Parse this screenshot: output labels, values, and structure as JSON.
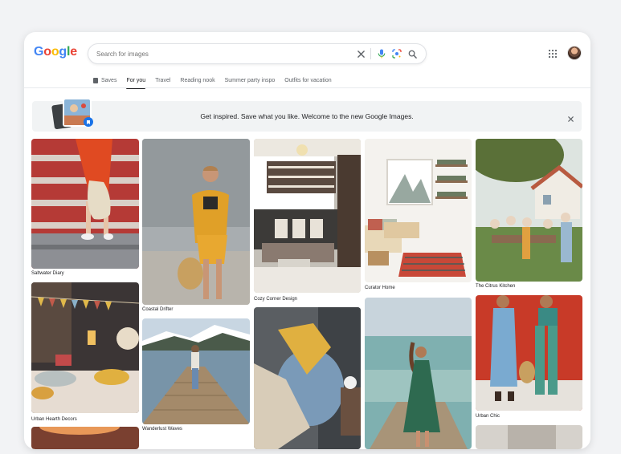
{
  "logo": {
    "letters": [
      "G",
      "o",
      "o",
      "g",
      "l",
      "e"
    ],
    "colors": [
      "#4285F4",
      "#EA4335",
      "#FBBC05",
      "#4285F4",
      "#34A853",
      "#EA4335"
    ]
  },
  "search": {
    "placeholder": "Search for images",
    "value": ""
  },
  "icons": {
    "clear": "close-icon",
    "mic": "microphone-icon",
    "lens": "camera-lens-icon",
    "search": "search-icon",
    "apps": "apps-grid-icon",
    "saves": "bookmark-icon"
  },
  "tabs": [
    {
      "label": "Saves"
    },
    {
      "label": "For you",
      "active": true
    },
    {
      "label": "Travel"
    },
    {
      "label": "Reading nook"
    },
    {
      "label": "Summer party inspo"
    },
    {
      "label": "Outfits for vacation"
    }
  ],
  "banner": {
    "text": "Get inspired. Save what you like. Welcome to the new Google Images."
  },
  "tiles": [
    {
      "caption": "Saltwater Diary"
    },
    {
      "caption": "Coastal Drifter"
    },
    {
      "caption": "Cozy Corner Design"
    },
    {
      "caption": "Curator Home"
    },
    {
      "caption": "The Citrus Kitchen"
    },
    {
      "caption": "Urban Hearth Decors"
    },
    {
      "caption": "Wanderlust Waves"
    },
    {
      "caption": ""
    },
    {
      "caption": ""
    },
    {
      "caption": "Urban Chic"
    }
  ],
  "colors": {
    "accent": "#1a73e8",
    "text": "#202124",
    "muted": "#5f6368"
  }
}
